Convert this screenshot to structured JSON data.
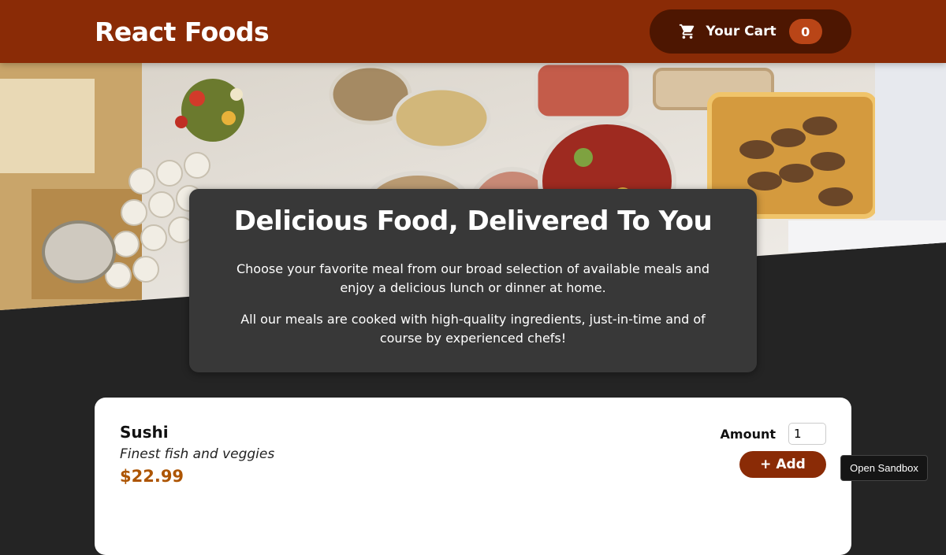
{
  "header": {
    "title": "React Foods"
  },
  "cart": {
    "label": "Your Cart",
    "count": "0",
    "icon": "shopping-cart-icon"
  },
  "hero": {
    "image": "buffet-table-photo"
  },
  "summary": {
    "title": "Delicious Food, Delivered To You",
    "paragraphs": [
      "Choose your favorite meal from our broad selection of available meals and enjoy a delicious lunch or dinner at home.",
      "All our meals are cooked with high-quality ingredients, just-in-time and of course by experienced chefs!"
    ]
  },
  "meals": [
    {
      "name": "Sushi",
      "description": "Finest fish and veggies",
      "price": "$22.99",
      "amount_label": "Amount",
      "amount_value": "1",
      "add_label": "+ Add"
    }
  ],
  "sandbox": {
    "label": "Open Sandbox"
  },
  "colors": {
    "header": "#8a2b06",
    "cart_bg": "#4d1601",
    "badge": "#b94517",
    "price": "#ad5502",
    "page_bg": "#242424",
    "card": "#383838"
  }
}
